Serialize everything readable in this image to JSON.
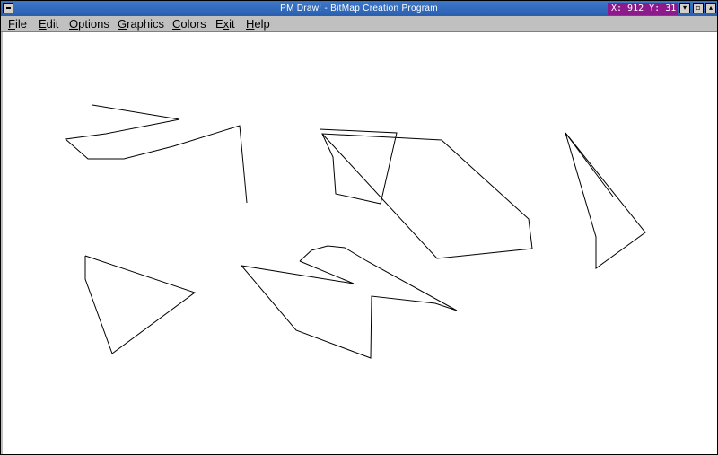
{
  "window": {
    "title": "PM Draw! - BitMap Creation Program",
    "coords": "X: 912  Y: 31",
    "buttons": {
      "minimize": "▾",
      "restore": "▫",
      "maximize": "▴"
    }
  },
  "menu": [
    {
      "pre": "",
      "u": "F",
      "post": "ile"
    },
    {
      "pre": "",
      "u": "E",
      "post": "dit"
    },
    {
      "pre": "",
      "u": "O",
      "post": "ptions"
    },
    {
      "pre": "",
      "u": "G",
      "post": "raphics"
    },
    {
      "pre": "",
      "u": "C",
      "post": "olors"
    },
    {
      "pre": "E",
      "u": "x",
      "post": "it"
    },
    {
      "pre": "",
      "u": "H",
      "post": "elp"
    }
  ],
  "colors": {
    "titlebar": "#2a5fb0",
    "coords_bg": "#8c1a8c",
    "stroke": "#000000",
    "canvas": "#ffffff"
  }
}
